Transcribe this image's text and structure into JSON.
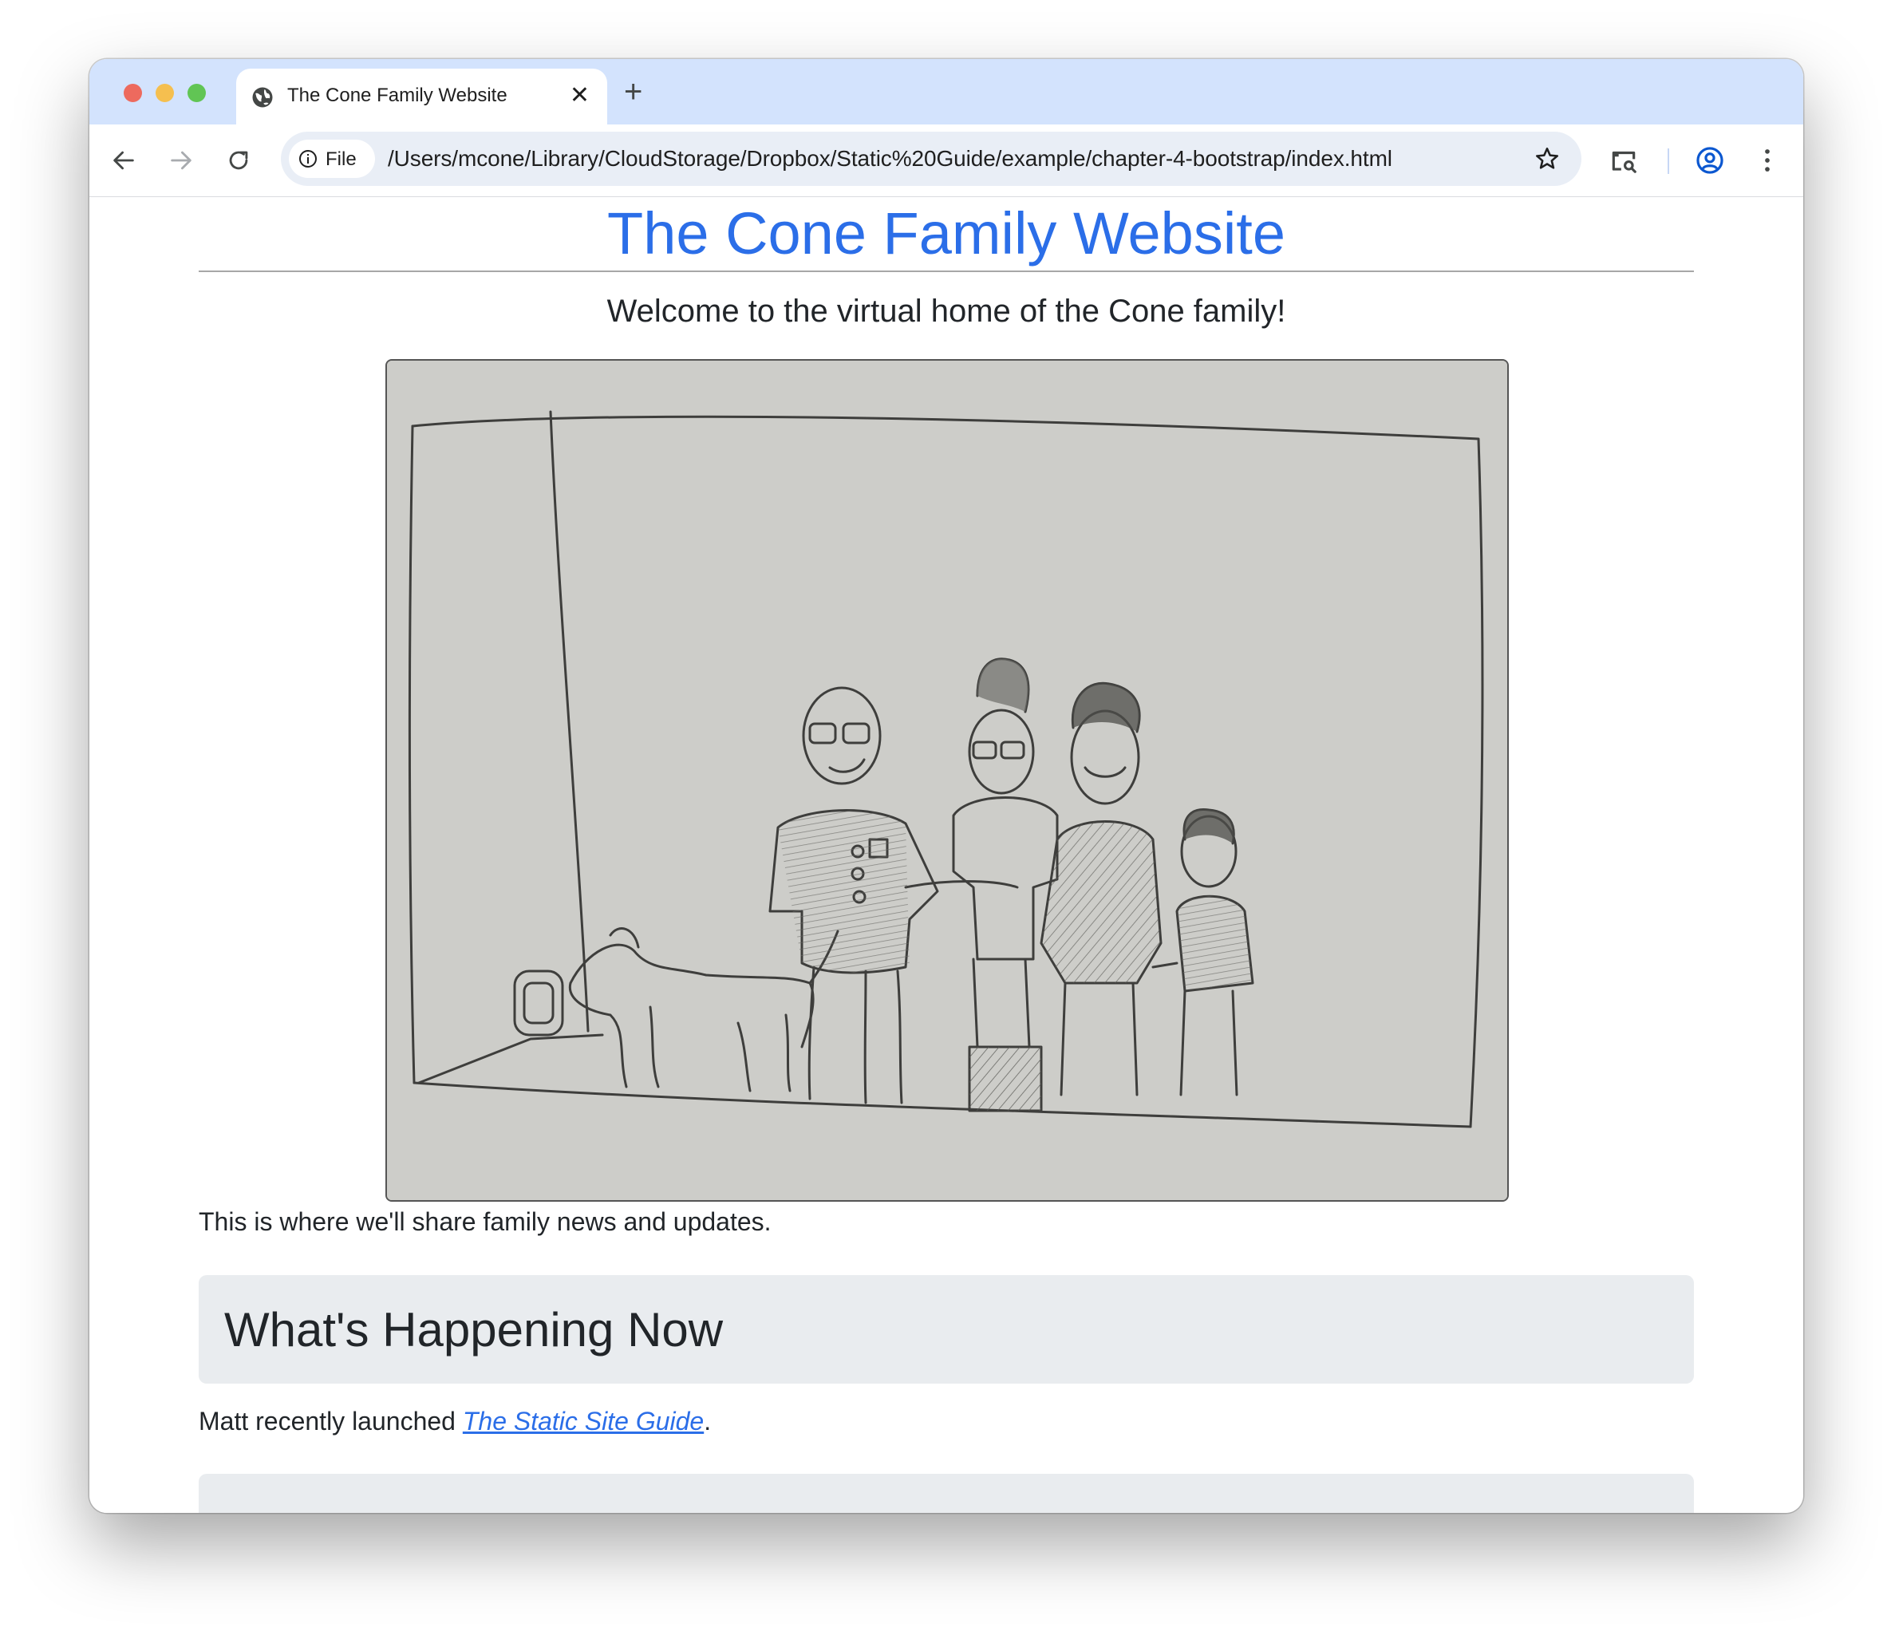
{
  "browser": {
    "tab": {
      "title": "The Cone Family Website",
      "close_label": "✕"
    },
    "new_tab_label": "+",
    "omnibox": {
      "chip_label": "File",
      "url": "/Users/mcone/Library/CloudStorage/Dropbox/Static%20Guide/example/chapter-4-bootstrap/index.html"
    }
  },
  "page": {
    "title": "The Cone Family Website",
    "lead": "Welcome to the virtual home of the Cone family!",
    "intro": "This is where we'll share family news and updates.",
    "section_heading": "What's Happening Now",
    "news_prefix": "Matt recently launched ",
    "news_link": "The Static Site Guide",
    "news_suffix": "."
  },
  "colors": {
    "tab_strip": "#d3e3fd",
    "title_link": "#2b6ee8",
    "section_bg": "#e9ecef"
  }
}
